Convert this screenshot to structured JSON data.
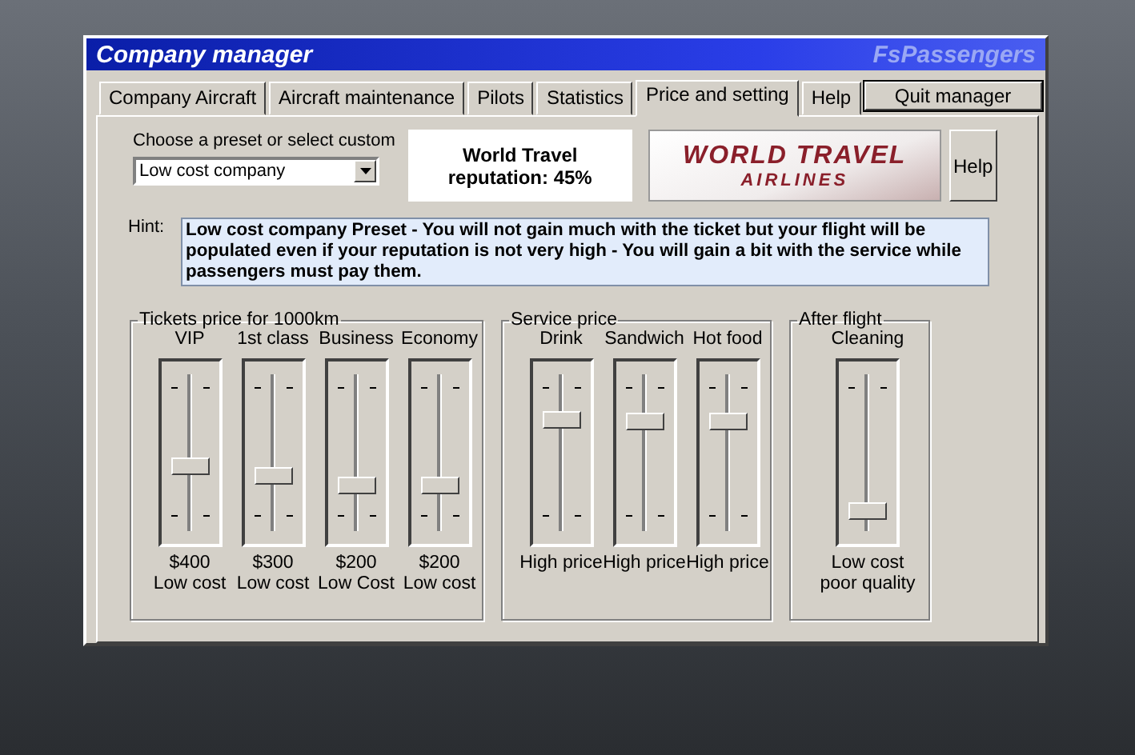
{
  "window": {
    "title": "Company manager",
    "brand": "FsPassengers"
  },
  "tabs": [
    {
      "label": "Company Aircraft",
      "selected": false
    },
    {
      "label": "Aircraft maintenance",
      "selected": false
    },
    {
      "label": "Pilots",
      "selected": false
    },
    {
      "label": "Statistics",
      "selected": false
    },
    {
      "label": "Price and setting",
      "selected": true
    },
    {
      "label": "Help",
      "selected": false
    }
  ],
  "quit_button": "Quit manager",
  "preset": {
    "label": "Choose a preset or select custom",
    "value": "Low cost company"
  },
  "reputation": {
    "line_1": "World Travel",
    "line_2": "reputation: 45%"
  },
  "logo": {
    "line_1": "WORLD TRAVEL",
    "line_2": "AIRLINES"
  },
  "help_button": "Help",
  "hint": {
    "label": "Hint:",
    "text": "Low cost company Preset - You will not gain much with the ticket but your flight will be populated even if your reputation is not very high - You will gain a bit with the service while passengers must pay them."
  },
  "groups": [
    {
      "title": "Tickets price for 1000km",
      "sliders": [
        {
          "label": "VIP",
          "level": 0.36,
          "caption": [
            "$400",
            "Low cost"
          ]
        },
        {
          "label": "1st class",
          "level": 0.29,
          "caption": [
            "$300",
            "Low cost"
          ]
        },
        {
          "label": "Business",
          "level": 0.23,
          "caption": [
            "$200",
            "Low Cost"
          ]
        },
        {
          "label": "Economy",
          "level": 0.23,
          "caption": [
            "$200",
            "Low cost"
          ]
        }
      ]
    },
    {
      "title": "Service price",
      "sliders": [
        {
          "label": "Drink",
          "level": 0.69,
          "caption": [
            "High price"
          ]
        },
        {
          "label": "Sandwich",
          "level": 0.68,
          "caption": [
            "High price"
          ]
        },
        {
          "label": "Hot food",
          "level": 0.68,
          "caption": [
            "High price"
          ]
        }
      ]
    },
    {
      "title": "After flight",
      "sliders": [
        {
          "label": "Cleaning",
          "level": 0.05,
          "caption": [
            "Low cost",
            "poor quality"
          ]
        }
      ]
    }
  ]
}
